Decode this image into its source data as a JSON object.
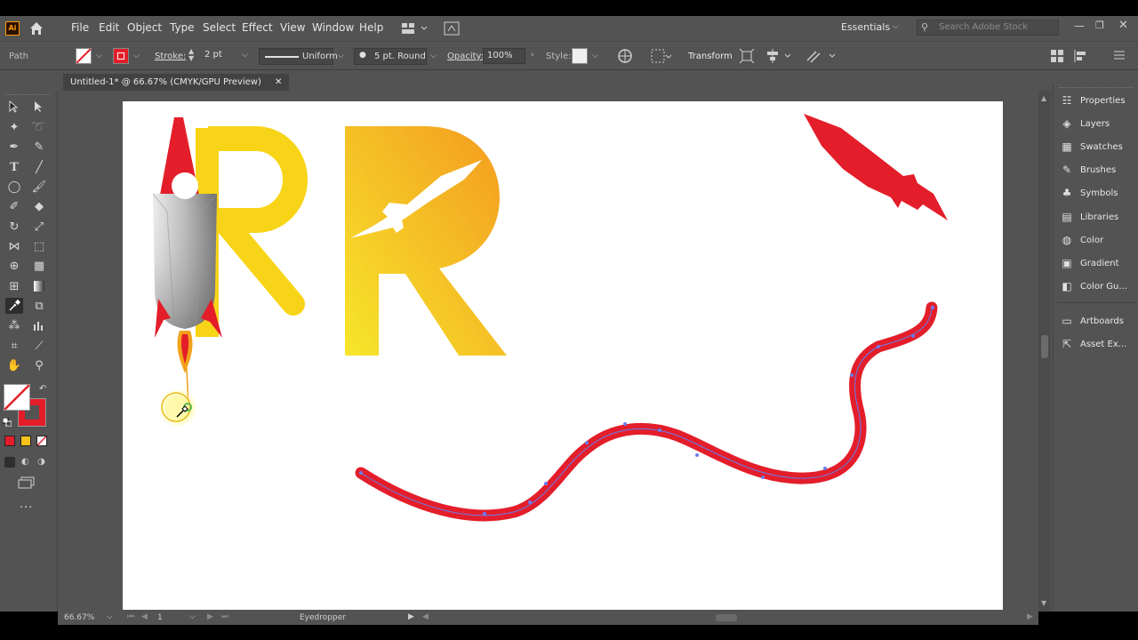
{
  "app": {
    "logo": "Ai"
  },
  "menu": [
    "File",
    "Edit",
    "Object",
    "Type",
    "Select",
    "Effect",
    "View",
    "Window",
    "Help"
  ],
  "workspace": {
    "name": "Essentials",
    "search_placeholder": "Search Adobe Stock"
  },
  "control": {
    "selection_label": "Path",
    "stroke_label": "Stroke:",
    "stroke_weight": "2 pt",
    "profile": "Uniform",
    "brush": "5 pt. Round",
    "opacity_label": "Opacity:",
    "opacity_value": "100%",
    "style_label": "Style:",
    "transform_label": "Transform"
  },
  "document": {
    "tab_title": "Untitled-1* @ 66.67% (CMYK/GPU Preview)",
    "close_glyph": "✕"
  },
  "panels": [
    {
      "icon": "properties-icon",
      "label": "Properties"
    },
    {
      "icon": "layers-icon",
      "label": "Layers"
    },
    {
      "icon": "swatches-icon",
      "label": "Swatches"
    },
    {
      "icon": "brushes-icon",
      "label": "Brushes"
    },
    {
      "icon": "symbols-icon",
      "label": "Symbols"
    },
    {
      "icon": "libraries-icon",
      "label": "Libraries"
    },
    {
      "icon": "color-icon",
      "label": "Color"
    },
    {
      "icon": "gradient-icon",
      "label": "Gradient"
    },
    {
      "icon": "color-guide-icon",
      "label": "Color Gu..."
    },
    {
      "icon": "artboards-icon",
      "label": "Artboards"
    },
    {
      "icon": "asset-export-icon",
      "label": "Asset Ex..."
    }
  ],
  "status": {
    "zoom": "66.67%",
    "artboard_number": "1",
    "tool_name": "Eyedropper"
  },
  "colors": {
    "red": "#e31e2a",
    "yellow": "#f7d417",
    "orange": "#f4a021",
    "panel_bg": "#535353"
  }
}
